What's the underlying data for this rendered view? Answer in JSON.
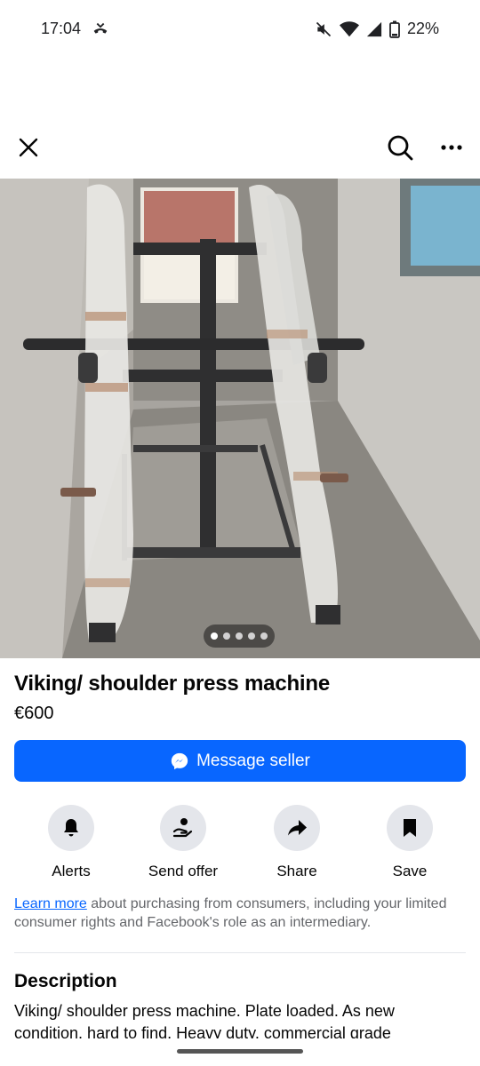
{
  "status": {
    "time": "17:04",
    "battery": "22%"
  },
  "toolbar": {
    "close_icon": "close-icon",
    "search_icon": "search-icon",
    "more_icon": "more-icon"
  },
  "listing": {
    "title": "Viking/ shoulder press machine",
    "price": "€600",
    "photo_count": 5,
    "active_photo": 1
  },
  "message_button": {
    "label": "Message seller",
    "icon": "messenger-icon"
  },
  "actions": [
    {
      "label": "Alerts",
      "icon": "bell-icon"
    },
    {
      "label": "Send offer",
      "icon": "offer-icon"
    },
    {
      "label": "Share",
      "icon": "share-icon"
    },
    {
      "label": "Save",
      "icon": "bookmark-icon"
    }
  ],
  "info": {
    "link_text": "Learn more",
    "text": " about purchasing from consumers, including your limited consumer rights and Facebook's role as an intermediary."
  },
  "description": {
    "heading": "Description",
    "body": "Viking/ shoulder press machine. Plate loaded. As new condition, hard to find. Heavy duty, commercial grade"
  },
  "colors": {
    "accent": "#0866ff",
    "action_bg": "#e4e6eb",
    "muted_text": "#65676b"
  }
}
